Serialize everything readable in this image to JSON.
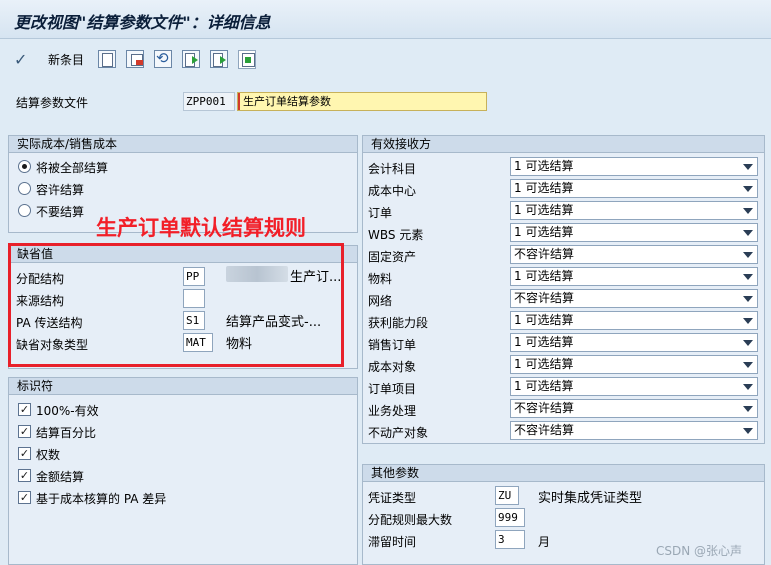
{
  "window": {
    "title": "更改视图\"结算参数文件\"：详细信息"
  },
  "toolbar": {
    "new_entries": "新条目"
  },
  "profile": {
    "label": "结算参数文件",
    "code": "ZPP001",
    "description": "生产订单结算参数"
  },
  "actual_costs": {
    "header": "实际成本/销售成本",
    "options": [
      "将被全部结算",
      "容许结算",
      "不要结算"
    ],
    "selected": "将被全部结算"
  },
  "annotation": "生产订单默认结算规则",
  "defaults": {
    "header": "缺省值",
    "rows": [
      {
        "label": "分配结构",
        "value": "PP",
        "text": "生产订..."
      },
      {
        "label": "来源结构",
        "value": "",
        "text": ""
      },
      {
        "label": "PA 传送结构",
        "value": "S1",
        "text": "结算产品变式-..."
      },
      {
        "label": "缺省对象类型",
        "value": "MAT",
        "text": "物料"
      }
    ]
  },
  "indicators": {
    "header": "标识符",
    "items": [
      {
        "label": "100%-有效",
        "checked": true
      },
      {
        "label": "结算百分比",
        "checked": true
      },
      {
        "label": "权数",
        "checked": true
      },
      {
        "label": "金额结算",
        "checked": true
      },
      {
        "label": "基于成本核算的 PA 差异",
        "checked": true
      }
    ]
  },
  "receivers": {
    "header": "有效接收方",
    "rows": [
      {
        "label": "会计科目",
        "value": "1 可选结算"
      },
      {
        "label": "成本中心",
        "value": "1 可选结算"
      },
      {
        "label": "订单",
        "value": "1 可选结算"
      },
      {
        "label": "WBS 元素",
        "value": "1 可选结算"
      },
      {
        "label": "固定资产",
        "value": " 不容许结算"
      },
      {
        "label": "物料",
        "value": "1 可选结算"
      },
      {
        "label": "网络",
        "value": " 不容许结算"
      },
      {
        "label": "获利能力段",
        "value": "1 可选结算"
      },
      {
        "label": "销售订单",
        "value": "1 可选结算"
      },
      {
        "label": "成本对象",
        "value": "1 可选结算"
      },
      {
        "label": "订单项目",
        "value": "1 可选结算"
      },
      {
        "label": "业务处理",
        "value": " 不容许结算"
      },
      {
        "label": "不动产对象",
        "value": " 不容许结算"
      }
    ]
  },
  "other": {
    "header": "其他参数",
    "doc_type_label": "凭证类型",
    "doc_type": "ZU",
    "doc_type_text": "实时集成凭证类型",
    "max_rules_label": "分配规则最大数",
    "max_rules": "999",
    "residence_label": "滞留时间",
    "residence": "3",
    "residence_unit": "月"
  },
  "watermark": "CSDN @张心声"
}
